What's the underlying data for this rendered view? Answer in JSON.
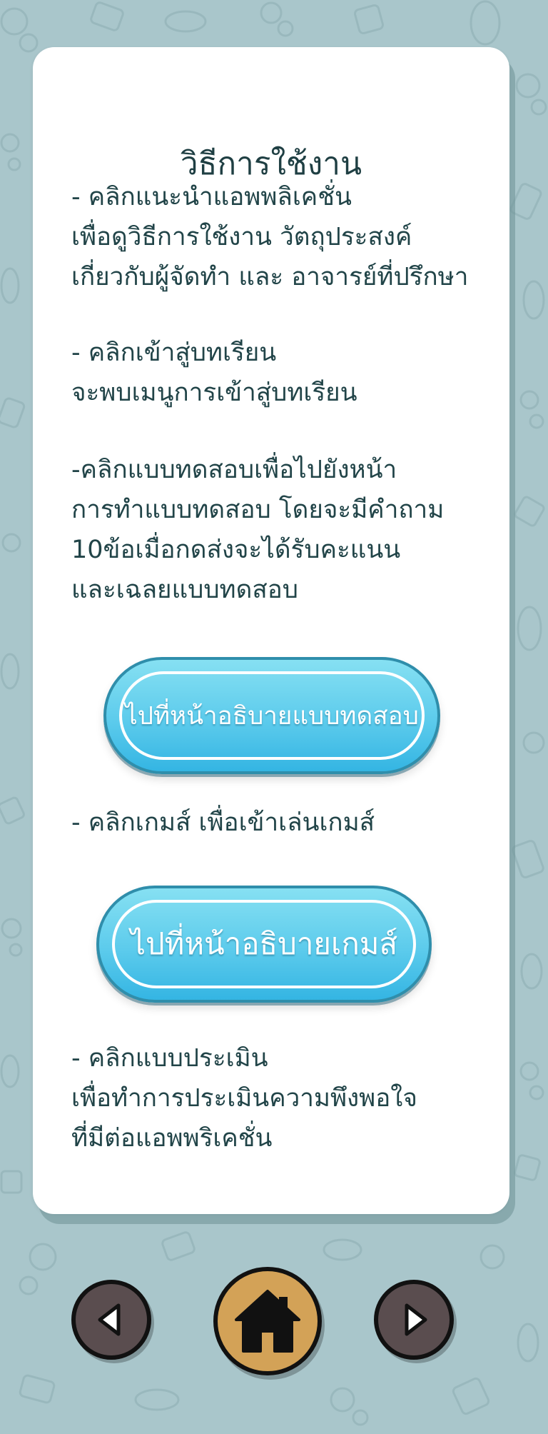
{
  "title": "วิธีการใช้งาน",
  "sections": [
    {
      "lines": [
        "- คลิกแนะนำแอพพลิเคชั่น",
        "เพื่อดูวิธีการใช้งาน วัตถุประสงค์",
        "เกี่ยวกับผู้จัดทำ และ อาจารย์ที่ปรึกษา"
      ]
    },
    {
      "lines": [
        "- คลิกเข้าสู่บทเรียน",
        "จะพบเมนูการเข้าสู่บทเรียน"
      ]
    },
    {
      "lines": [
        "-คลิกแบบทดสอบเพื่อไปยังหน้า",
        "การทำแบบทดสอบ โดยจะมีคำถาม",
        "10ข้อเมื่อกดส่งจะได้รับคะแนน",
        "และเฉลยแบบทดสอบ"
      ]
    },
    {
      "lines": [
        "- คลิกเกมส์ เพื่อเข้าเล่นเกมส์"
      ]
    },
    {
      "lines": [
        "- คลิกแบบประเมิน",
        "เพื่อทำการประเมินความพึงพอใจ",
        "ที่มีต่อแอพพริเคชั่น"
      ]
    }
  ],
  "buttons": {
    "quiz": "ไปที่หน้าอธิบายแบบทดสอบ",
    "game": "ไปที่หน้าอธิบายเกมส์"
  },
  "nav": {
    "prev_icon": "arrow-left-icon",
    "home_icon": "home-icon",
    "next_icon": "arrow-right-icon"
  },
  "colors": {
    "background": "#a9c6cb",
    "card": "#ffffff",
    "text": "#214448",
    "pill_button": "#5ccbec",
    "nav_button": "#5a4d4f",
    "home_button": "#d3a257"
  }
}
